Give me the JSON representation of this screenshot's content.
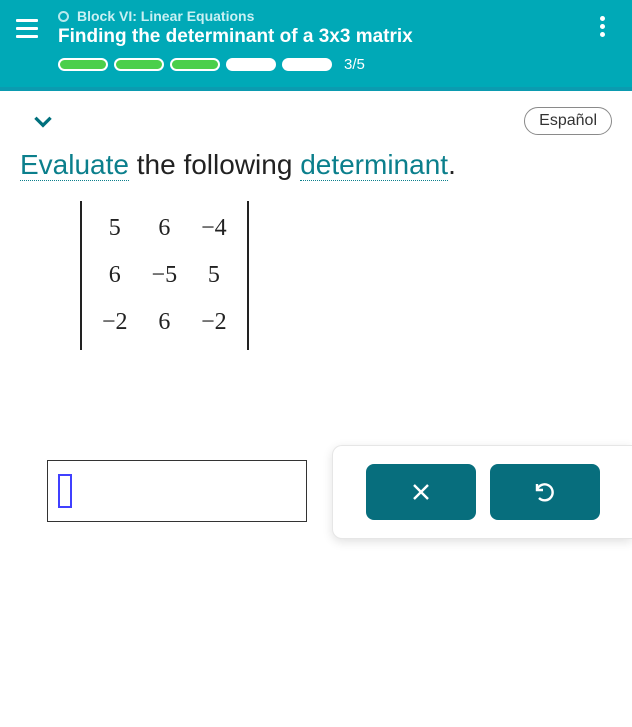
{
  "header": {
    "block_label": "Block VI: Linear Equations",
    "title": "Finding the determinant of a 3x3 matrix",
    "progress": {
      "segments": [
        true,
        true,
        true,
        false,
        false
      ],
      "label": "3/5"
    }
  },
  "language_button": "Español",
  "question": {
    "word_evaluate": "Evaluate",
    "middle": " the following ",
    "word_determinant": "determinant",
    "tail": "."
  },
  "matrix": [
    [
      "5",
      "6",
      "−4"
    ],
    [
      "6",
      "−5",
      "5"
    ],
    [
      "−2",
      "6",
      "−2"
    ]
  ],
  "answer_value": ""
}
